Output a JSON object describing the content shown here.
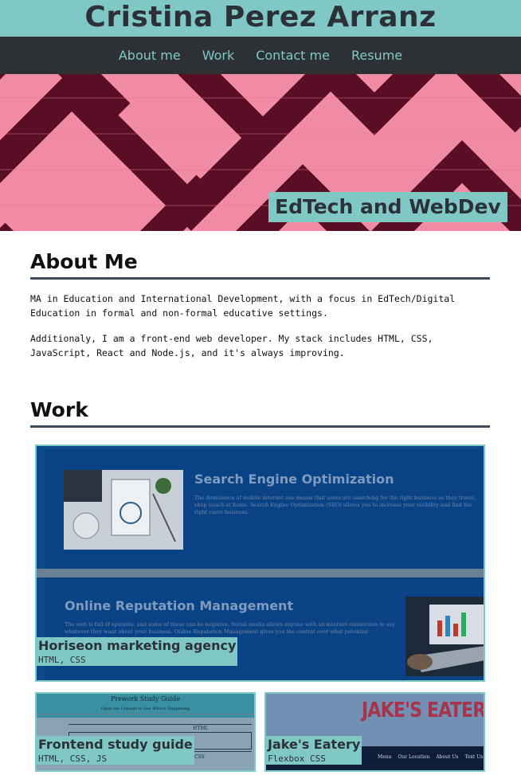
{
  "site": {
    "title": "Cristina Perez Arranz",
    "nav": [
      "About me",
      "Work",
      "Contact me",
      "Resume"
    ],
    "hero_tagline": "EdTech and WebDev"
  },
  "about": {
    "heading": "About Me",
    "paragraphs": [
      "MA in Education and International Development, with a focus in EdTech/Digital Education in formal and non-formal educative settings.",
      "Additionaly, I am a front-end web developer. My stack includes HTML, CSS, JavaScript, React and Node.js, and it's always improving."
    ]
  },
  "work": {
    "heading": "Work",
    "projects": [
      {
        "name": "Horiseon marketing agency",
        "tech": "HTML, CSS",
        "preview": {
          "heading_1": "Search Engine Optimization",
          "text_1": "The dominance of mobile internet use means that users are searching for the right business as they travel, shop couch at home. Search Engine Optimization (SEO) allows you to increase your visibility and find the right custo business.",
          "heading_2": "Online Reputation Management",
          "text_2": "The web is full of opinions, and some of these can be negative. Social media allows anyone with an internet connection to say whatever they want about your business. Online Reputation Management gives you the control over what potential customers"
        }
      },
      {
        "name": "Frontend study guide",
        "tech": "HTML, CSS, JS",
        "preview": {
          "title": "Prework Study Guide",
          "subtitle": "Open the Console to See What's Happening",
          "row_1": "HTML",
          "row_2": "CSS"
        }
      },
      {
        "name": "Jake's Eatery",
        "tech": "Flexbox CSS",
        "preview": {
          "brand": "JAKE'S EATER",
          "menu": [
            "Menu",
            "Our Location",
            "About Us",
            "Text Us"
          ]
        }
      }
    ]
  },
  "colors": {
    "accent": "#7fc8c6",
    "nav_bg": "#2d3035",
    "hero_pink": "#f18aa3",
    "hero_dark": "#5a0e26",
    "divider": "#3d4c5c"
  }
}
